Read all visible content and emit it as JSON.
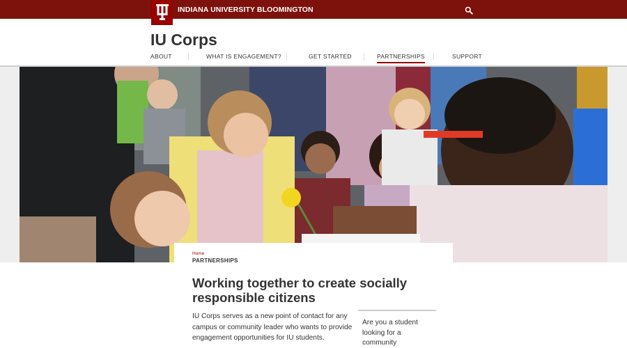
{
  "brand": {
    "logo": "iu-trident-icon",
    "campus_name": "INDIANA UNIVERSITY BLOOMINGTON",
    "search_icon": "search-icon",
    "colors": {
      "crimson": "#990000",
      "dark_crimson": "#7d110c"
    }
  },
  "site": {
    "title": "IU Corps"
  },
  "nav": {
    "items": [
      {
        "label": "ABOUT"
      },
      {
        "label": "WHAT IS ENGAGEMENT?"
      },
      {
        "label": "GET STARTED"
      },
      {
        "label": "PARTNERSHIPS"
      },
      {
        "label": "SUPPORT"
      }
    ],
    "active": "PARTNERSHIPS"
  },
  "breadcrumb": {
    "home": "Home",
    "current": "PARTNERSHIPS"
  },
  "main": {
    "headline": "Working together to create socially responsible citizens",
    "body": "IU Corps serves as a new point of contact for any campus or community leader who wants to provide engagement opportunities for IU students.",
    "aside": "Are you a student looking for a community"
  }
}
